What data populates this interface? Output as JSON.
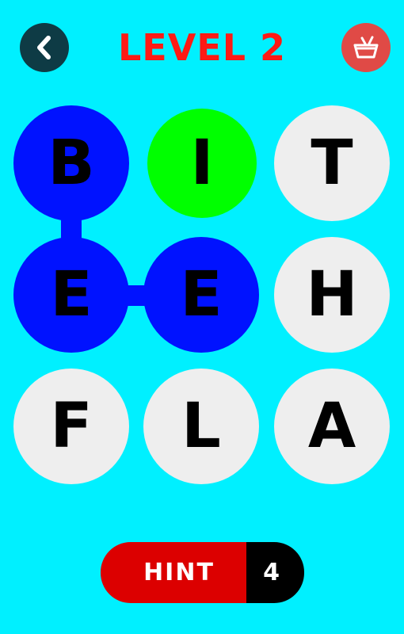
{
  "header": {
    "title": "LEVEL 2",
    "back_icon": "chevron-left-icon",
    "shop_icon": "basket-icon"
  },
  "board": {
    "rows": [
      [
        {
          "letter": "B",
          "state": "selected"
        },
        {
          "letter": "I",
          "state": "hint"
        },
        {
          "letter": "T",
          "state": "idle"
        }
      ],
      [
        {
          "letter": "E",
          "state": "selected"
        },
        {
          "letter": "E",
          "state": "selected"
        },
        {
          "letter": "H",
          "state": "idle"
        }
      ],
      [
        {
          "letter": "F",
          "state": "idle"
        },
        {
          "letter": "L",
          "state": "idle"
        },
        {
          "letter": "A",
          "state": "idle"
        }
      ]
    ]
  },
  "hint_button": {
    "label": "HINT",
    "count": "4"
  },
  "colors": {
    "background": "#00f0ff",
    "title": "#ff1a14",
    "selected": "#0012ff",
    "hint": "#00ff00",
    "idle": "#eeeeee",
    "hint_button": "#dc0000"
  }
}
